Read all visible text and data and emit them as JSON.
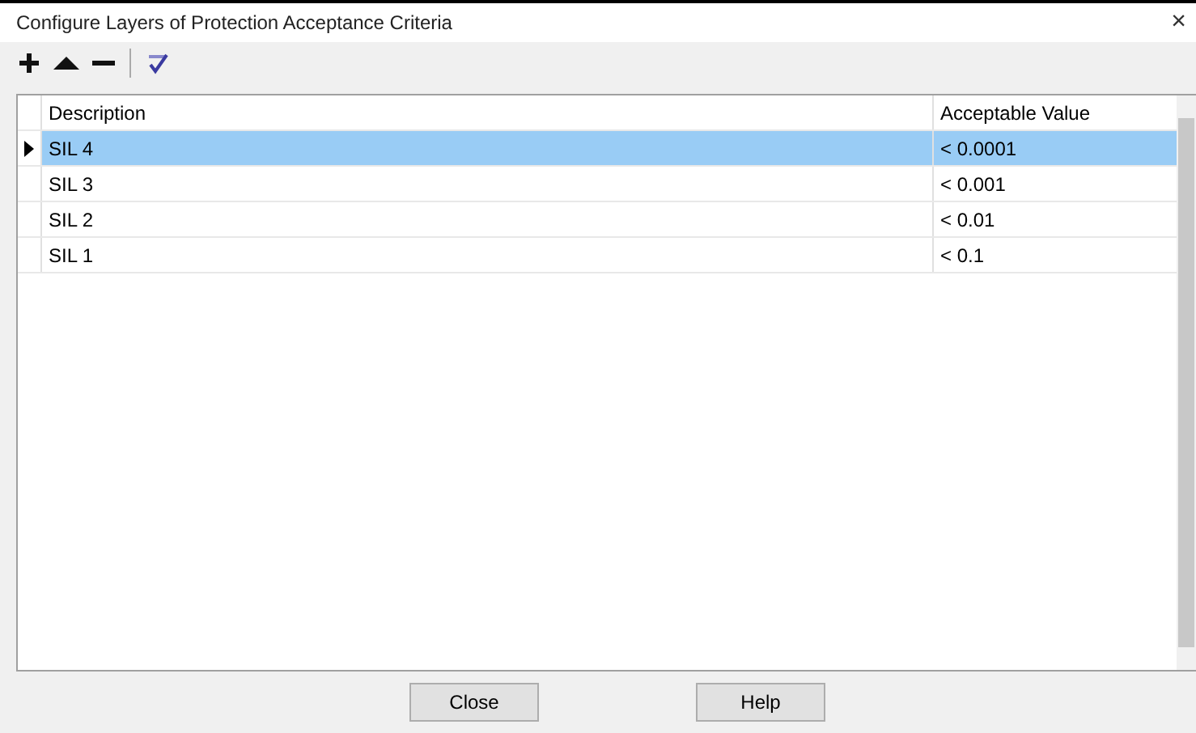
{
  "window": {
    "title": "Configure Layers of Protection Acceptance Criteria",
    "close": "×"
  },
  "toolbar": [
    {
      "kind": "add"
    },
    {
      "kind": "up"
    },
    {
      "kind": "remove"
    },
    {
      "kind": "spellcheck"
    }
  ],
  "table": {
    "columns": [
      "Description",
      "Acceptable Value"
    ],
    "rows": [
      {
        "description": "SIL 4",
        "value": "< 0.0001",
        "selected": true
      },
      {
        "description": "SIL 3",
        "value": "< 0.001",
        "selected": false
      },
      {
        "description": "SIL 2",
        "value": "< 0.01",
        "selected": false
      },
      {
        "description": "SIL 1",
        "value": "< 0.1",
        "selected": false
      }
    ]
  },
  "buttons": [
    "Close",
    "Help"
  ]
}
